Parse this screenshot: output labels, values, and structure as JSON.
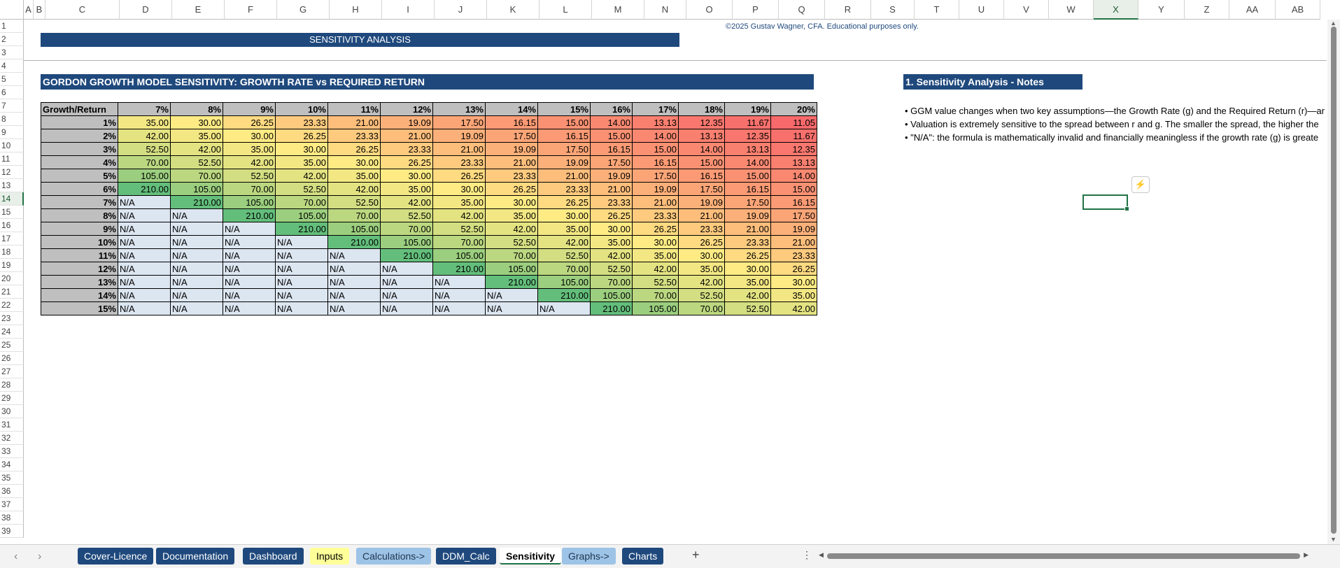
{
  "columns": [
    "A",
    "B",
    "C",
    "D",
    "E",
    "F",
    "G",
    "H",
    "I",
    "J",
    "K",
    "L",
    "M",
    "N",
    "O",
    "P",
    "Q",
    "R",
    "S",
    "T",
    "U",
    "V",
    "W",
    "X",
    "Y",
    "Z",
    "AA",
    "AB"
  ],
  "selected_column": "X",
  "rows": [
    1,
    2,
    3,
    4,
    5,
    6,
    7,
    8,
    9,
    10,
    11,
    12,
    13,
    14,
    15,
    16,
    17,
    18,
    19,
    20,
    21,
    22,
    23,
    24,
    25,
    26,
    27,
    28,
    29,
    30,
    31,
    32,
    33,
    34,
    35,
    36,
    37,
    38,
    39
  ],
  "selected_row": 14,
  "title": "SENSITIVITY ANALYSIS",
  "copyright": "©2025 Gustav Wagner, CFA. Educational purposes only.",
  "section_title": "GORDON GROWTH MODEL SENSITIVITY: GROWTH RATE vs REQUIRED RETURN",
  "notes_title": "1. Sensitivity Analysis - Notes",
  "notes": [
    "• GGM value changes when two key assumptions—the Growth Rate (g) and the Required Return (r)—ar",
    "• Valuation is extremely sensitive to the spread between r and g. The smaller the spread, the higher the",
    "• \"N/A\": the formula is mathematically invalid and financially meaningless if the growth rate (g) is greate"
  ],
  "table": {
    "corner_label": "Growth/Return",
    "returns": [
      "7%",
      "8%",
      "9%",
      "10%",
      "11%",
      "12%",
      "13%",
      "14%",
      "15%",
      "16%",
      "17%",
      "18%",
      "19%",
      "20%"
    ],
    "growth": [
      "1%",
      "2%",
      "3%",
      "4%",
      "5%",
      "6%",
      "7%",
      "8%",
      "9%",
      "10%",
      "11%",
      "12%",
      "13%",
      "14%",
      "15%"
    ],
    "values": [
      [
        "35.00",
        "30.00",
        "26.25",
        "23.33",
        "21.00",
        "19.09",
        "17.50",
        "16.15",
        "15.00",
        "14.00",
        "13.13",
        "12.35",
        "11.67",
        "11.05"
      ],
      [
        "42.00",
        "35.00",
        "30.00",
        "26.25",
        "23.33",
        "21.00",
        "19.09",
        "17.50",
        "16.15",
        "15.00",
        "14.00",
        "13.13",
        "12.35",
        "11.67"
      ],
      [
        "52.50",
        "42.00",
        "35.00",
        "30.00",
        "26.25",
        "23.33",
        "21.00",
        "19.09",
        "17.50",
        "16.15",
        "15.00",
        "14.00",
        "13.13",
        "12.35"
      ],
      [
        "70.00",
        "52.50",
        "42.00",
        "35.00",
        "30.00",
        "26.25",
        "23.33",
        "21.00",
        "19.09",
        "17.50",
        "16.15",
        "15.00",
        "14.00",
        "13.13"
      ],
      [
        "105.00",
        "70.00",
        "52.50",
        "42.00",
        "35.00",
        "30.00",
        "26.25",
        "23.33",
        "21.00",
        "19.09",
        "17.50",
        "16.15",
        "15.00",
        "14.00"
      ],
      [
        "210.00",
        "105.00",
        "70.00",
        "52.50",
        "42.00",
        "35.00",
        "30.00",
        "26.25",
        "23.33",
        "21.00",
        "19.09",
        "17.50",
        "16.15",
        "15.00"
      ],
      [
        "N/A",
        "210.00",
        "105.00",
        "70.00",
        "52.50",
        "42.00",
        "35.00",
        "30.00",
        "26.25",
        "23.33",
        "21.00",
        "19.09",
        "17.50",
        "16.15"
      ],
      [
        "N/A",
        "N/A",
        "210.00",
        "105.00",
        "70.00",
        "52.50",
        "42.00",
        "35.00",
        "30.00",
        "26.25",
        "23.33",
        "21.00",
        "19.09",
        "17.50"
      ],
      [
        "N/A",
        "N/A",
        "N/A",
        "210.00",
        "105.00",
        "70.00",
        "52.50",
        "42.00",
        "35.00",
        "30.00",
        "26.25",
        "23.33",
        "21.00",
        "19.09"
      ],
      [
        "N/A",
        "N/A",
        "N/A",
        "N/A",
        "210.00",
        "105.00",
        "70.00",
        "52.50",
        "42.00",
        "35.00",
        "30.00",
        "26.25",
        "23.33",
        "21.00"
      ],
      [
        "N/A",
        "N/A",
        "N/A",
        "N/A",
        "N/A",
        "210.00",
        "105.00",
        "70.00",
        "52.50",
        "42.00",
        "35.00",
        "30.00",
        "26.25",
        "23.33"
      ],
      [
        "N/A",
        "N/A",
        "N/A",
        "N/A",
        "N/A",
        "N/A",
        "210.00",
        "105.00",
        "70.00",
        "52.50",
        "42.00",
        "35.00",
        "30.00",
        "26.25"
      ],
      [
        "N/A",
        "N/A",
        "N/A",
        "N/A",
        "N/A",
        "N/A",
        "N/A",
        "210.00",
        "105.00",
        "70.00",
        "52.50",
        "42.00",
        "35.00",
        "30.00"
      ],
      [
        "N/A",
        "N/A",
        "N/A",
        "N/A",
        "N/A",
        "N/A",
        "N/A",
        "N/A",
        "210.00",
        "105.00",
        "70.00",
        "52.50",
        "42.00",
        "35.00"
      ],
      [
        "N/A",
        "N/A",
        "N/A",
        "N/A",
        "N/A",
        "N/A",
        "N/A",
        "N/A",
        "N/A",
        "210.00",
        "105.00",
        "70.00",
        "52.50",
        "42.00"
      ]
    ],
    "color_scale": {
      "low": "#f8696b",
      "mid": "#ffeb84",
      "high": "#63be7b",
      "na": "#dce6f1"
    }
  },
  "tabs": [
    {
      "label": "Cover-Licence",
      "style": "dark"
    },
    {
      "label": "Documentation",
      "style": "dark"
    },
    {
      "label": "Dashboard",
      "style": "dark"
    },
    {
      "label": "Inputs",
      "style": "yellow"
    },
    {
      "label": "Calculations->",
      "style": "light"
    },
    {
      "label": "DDM_Calc",
      "style": "dark"
    },
    {
      "label": "Sensitivity",
      "style": "active"
    },
    {
      "label": "Graphs->",
      "style": "light"
    },
    {
      "label": "Charts",
      "style": "dark"
    }
  ],
  "add_tab_label": "+",
  "icons": {
    "prev": "chevron-left-icon",
    "next": "chevron-right-icon",
    "more": "more-options-icon",
    "quick": "quick-analysis-icon"
  }
}
